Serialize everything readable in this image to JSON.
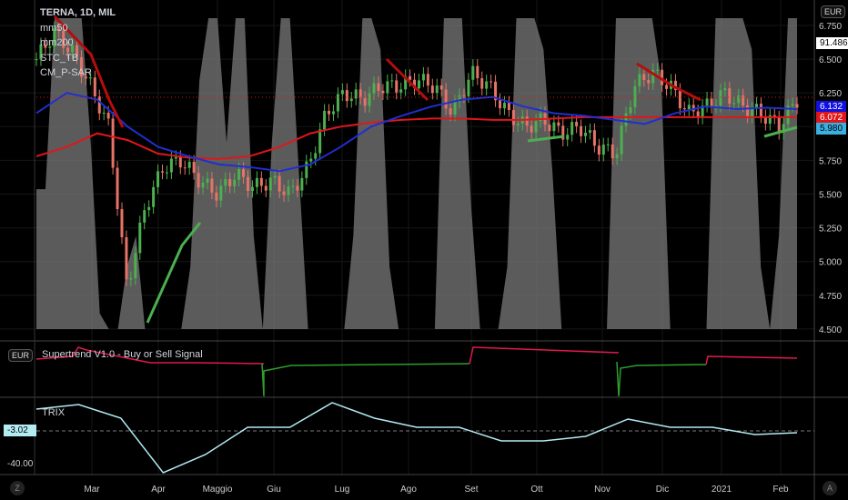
{
  "header": {
    "symbol": "TERNA, 1D, MIL",
    "indicators": [
      "mm50",
      "mm200",
      "STC_TB",
      "CM_P-SAR"
    ],
    "currency": "EUR"
  },
  "supertrend": {
    "title": "Supertrend V1.0 - Buy or Sell Signal",
    "currency": "EUR"
  },
  "trix": {
    "title": "TRIX",
    "last_label": "-3.02",
    "tick": "-40.00"
  },
  "price_labels": {
    "top": "91.486",
    "mm50": "6.132",
    "mm200": "6.072",
    "psar": "5.980"
  },
  "corner": {
    "left": "Z",
    "right": "A"
  },
  "colors": {
    "mm50": "#1f2fd0",
    "mm200": "#e0161b",
    "psar_up": "#4caf50",
    "psar_down": "#b50d0d",
    "stc": "#7a7a7a",
    "trix": "#b2ebf2",
    "supertrend_sell": "#e0194e",
    "supertrend_buy": "#2e9e2e"
  },
  "chart_data": {
    "type": "line",
    "title": "TERNA, 1D, MIL",
    "x_ticks": [
      "Mar",
      "Apr",
      "Maggio",
      "Giu",
      "Lug",
      "Ago",
      "Set",
      "Ott",
      "Nov",
      "Dic",
      "2021",
      "Feb"
    ],
    "y_ticks": [
      "6.750",
      "6.500",
      "6.250",
      "6.000",
      "5.750",
      "5.500",
      "5.250",
      "5.000",
      "4.750",
      "4.500"
    ],
    "ylim": [
      4.5,
      6.75
    ],
    "price": [
      6.5,
      6.7,
      6.55,
      6.3,
      6.0,
      4.8,
      5.4,
      5.7,
      5.75,
      5.6,
      5.5,
      5.65,
      5.55,
      5.6,
      5.5,
      5.7,
      6.1,
      6.25,
      6.2,
      6.3,
      6.3,
      6.35,
      6.3,
      6.1,
      6.4,
      6.3,
      6.1,
      6.0,
      6.05,
      5.95,
      6.0,
      5.85,
      5.8,
      6.3,
      6.4,
      6.3,
      6.1,
      6.15,
      6.25,
      6.15,
      6.1,
      6.0,
      6.2
    ],
    "mm50": [
      6.1,
      6.25,
      6.2,
      6.0,
      5.85,
      5.78,
      5.72,
      5.7,
      5.67,
      5.72,
      5.85,
      6.0,
      6.08,
      6.15,
      6.2,
      6.22,
      6.15,
      6.1,
      6.08,
      6.05,
      6.02,
      6.1,
      6.15,
      6.13,
      6.14,
      6.13
    ],
    "mm200": [
      5.78,
      5.85,
      5.95,
      5.9,
      5.8,
      5.77,
      5.76,
      5.78,
      5.85,
      5.95,
      6.0,
      6.03,
      6.05,
      6.06,
      6.06,
      6.05,
      6.05,
      6.06,
      6.07,
      6.07,
      6.07,
      6.07,
      6.07,
      6.07,
      6.07,
      6.07
    ],
    "stc": [
      45,
      45,
      100,
      100,
      100,
      100,
      60,
      5,
      0,
      0,
      20,
      30,
      0,
      0,
      0,
      0,
      0,
      20,
      80,
      100,
      100,
      60,
      100,
      100,
      30,
      0,
      60,
      100,
      100,
      50,
      0,
      0,
      0,
      0,
      0,
      30,
      100,
      100,
      90,
      20,
      0,
      0,
      0,
      0,
      0,
      100,
      100,
      100,
      40,
      0,
      0,
      0,
      20,
      100,
      100,
      100,
      90,
      50,
      0,
      0,
      0,
      0,
      0,
      0,
      100,
      100,
      100,
      100,
      100,
      80,
      0,
      0,
      0,
      0,
      0,
      100,
      100,
      100,
      100,
      90,
      20,
      0,
      30,
      100,
      100
    ],
    "trix": [
      21,
      26,
      11,
      -49,
      -29,
      1,
      1,
      28,
      11,
      1,
      1,
      -14,
      -14,
      -9,
      10,
      1,
      1,
      -7,
      -5
    ],
    "trix_ylabel": "TRIX"
  }
}
